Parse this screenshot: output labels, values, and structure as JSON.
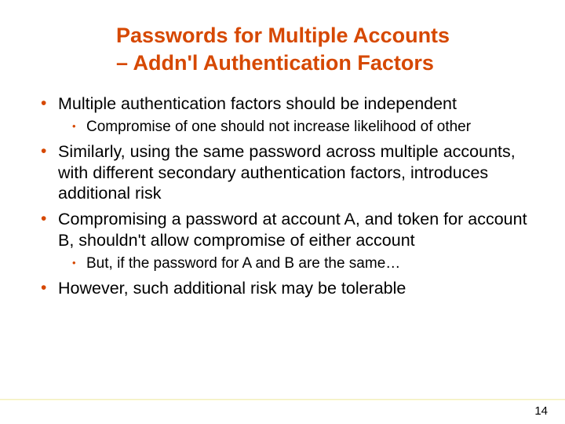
{
  "title_line1": "Passwords for Multiple Accounts",
  "title_line2": "– Addn'l Authentication Factors",
  "bullets": {
    "b1": "Multiple authentication factors should be independent",
    "b1_1": "Compromise of one should not increase likelihood of other",
    "b2": "Similarly, using the same password across multiple accounts, with different secondary authentication factors, introduces additional risk",
    "b3": "Compromising a password at account A, and token for account B, shouldn't allow compromise of either account",
    "b3_1": "But, if the password for A and B are the same…",
    "b4": "However, such additional risk may be tolerable"
  },
  "page_number": "14"
}
